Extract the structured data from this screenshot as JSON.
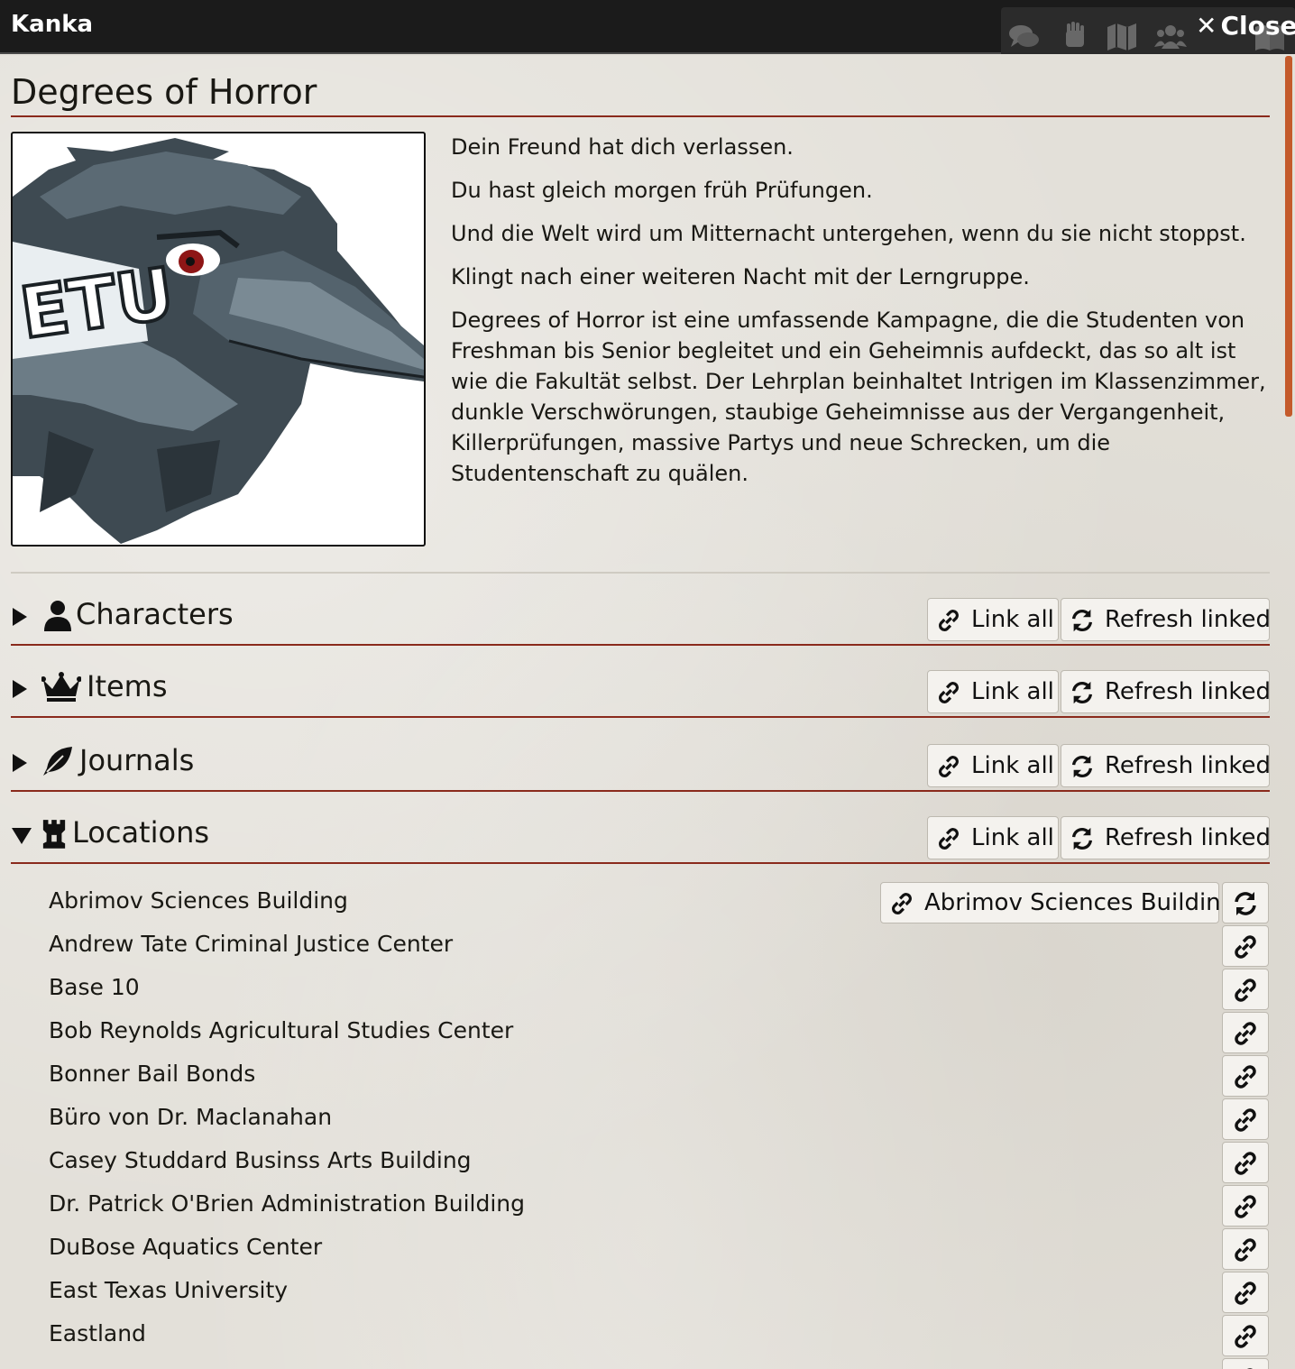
{
  "titlebar": {
    "app_title": "Kanka",
    "close_label": "Close",
    "tab_icons": [
      "chat-icon",
      "hand-icon",
      "map-icon",
      "users-icon",
      "journal-icon"
    ]
  },
  "sheet": {
    "title": "Degrees of Horror",
    "image_label": "ETU",
    "description": [
      "Dein Freund hat dich verlassen.",
      "Du hast gleich morgen früh Prüfungen.",
      "Und die Welt wird um Mitternacht untergehen, wenn du sie nicht stoppst.",
      "Klingt nach einer weiteren Nacht mit der Lerngruppe.",
      "Degrees of Horror ist eine umfassende Kampagne, die die Studenten von Freshman bis Senior begleitet und ein Geheimnis aufdeckt, das so alt ist wie die Fakultät selbst. Der Lehrplan beinhaltet Intrigen im Klassenzimmer, dunkle Verschwörungen, staubige Geheimnisse aus der Vergangenheit, Killerprüfungen, massive Partys und neue Schrecken, um die Studentenschaft zu quälen."
    ]
  },
  "buttons": {
    "link_all": "Link all",
    "refresh_linked": "Refresh linked"
  },
  "sections": [
    {
      "label": "Characters",
      "icon": "user-icon",
      "expanded": false
    },
    {
      "label": "Items",
      "icon": "crown-icon",
      "expanded": false
    },
    {
      "label": "Journals",
      "icon": "feather-icon",
      "expanded": false
    },
    {
      "label": "Locations",
      "icon": "castle-icon",
      "expanded": true
    }
  ],
  "locations": {
    "linked_button_label": "Abrimov Sciences Building",
    "items": [
      "Abrimov Sciences Building",
      "Andrew Tate Criminal Justice Center",
      "Base 10",
      "Bob Reynolds Agricultural Studies Center",
      "Bonner Bail Bonds",
      "Büro von Dr. Maclanahan",
      "Casey Studdard Businss Arts Building",
      "Dr. Patrick O'Brien Administration Building",
      "DuBose Aquatics Center",
      "East Texas University",
      "Eastland"
    ]
  },
  "colors": {
    "accent_rule": "#8a2a1c",
    "titlebar_bg": "#1b1b1b",
    "scrollbar": "#c45a2b"
  }
}
